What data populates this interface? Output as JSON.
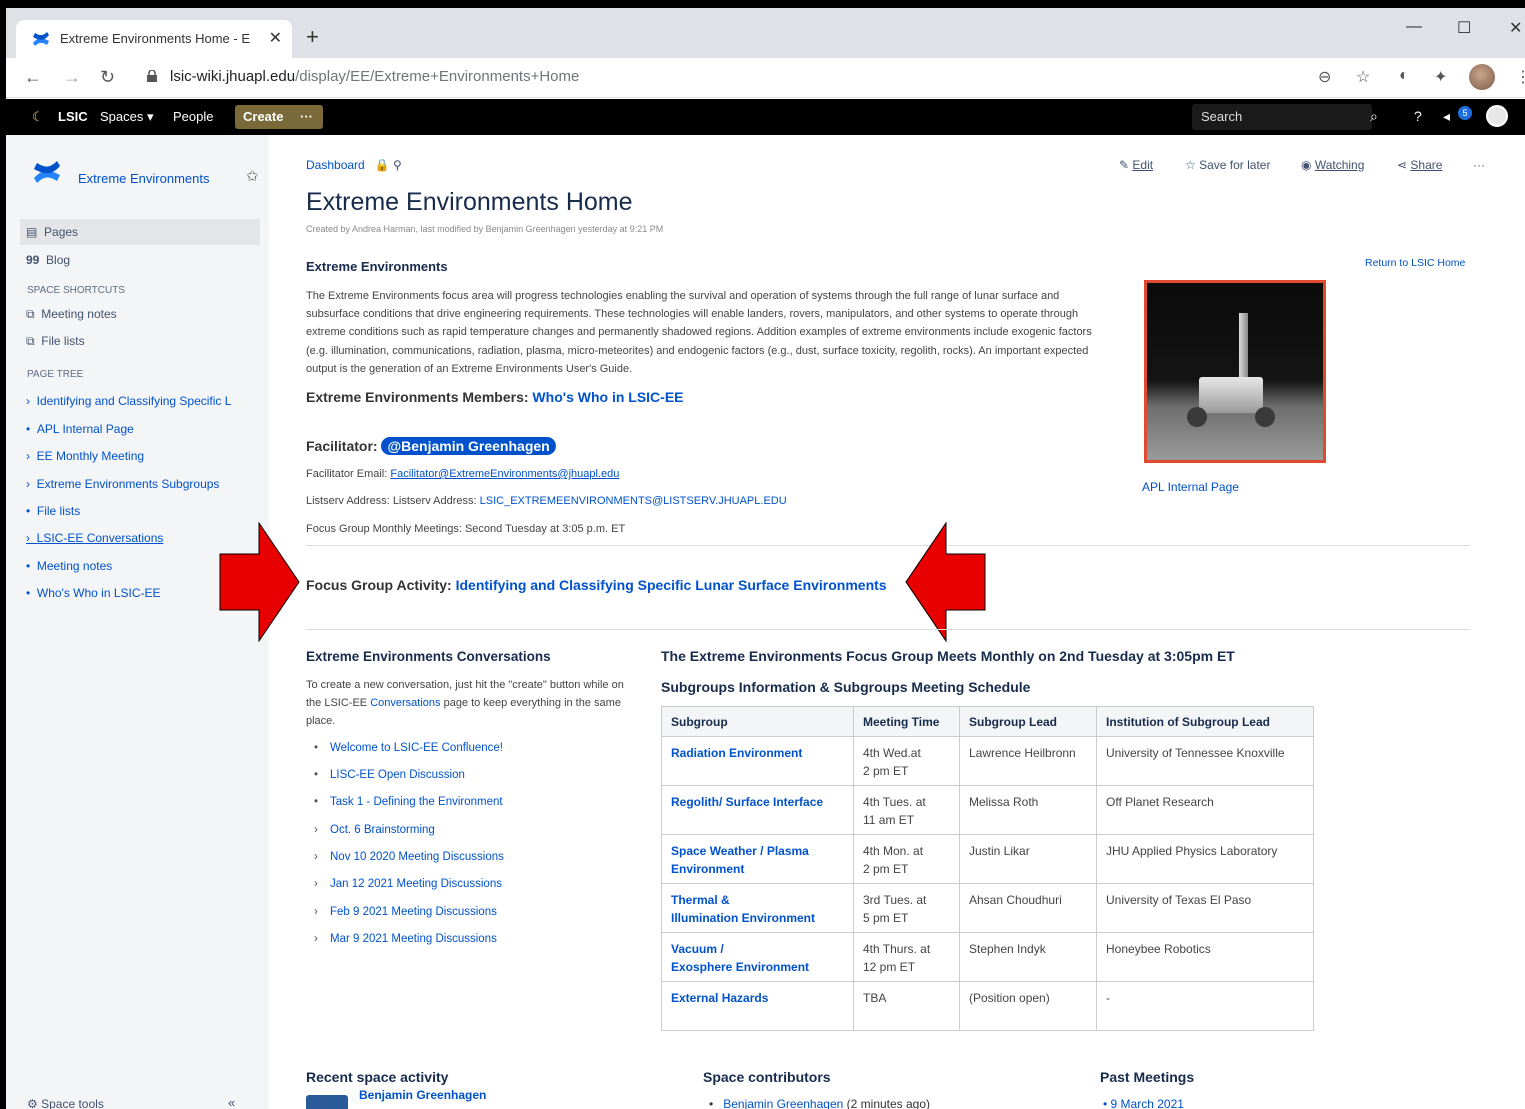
{
  "browser": {
    "tab_title": "Extreme Environments Home - E",
    "url_domain": "lsic-wiki.jhuapl.edu",
    "url_path": "/display/EE/Extreme+Environments+Home"
  },
  "topnav": {
    "logo": "LSIC",
    "spaces": "Spaces",
    "people": "People",
    "create": "Create",
    "more": "···",
    "search_placeholder": "Search",
    "notif_count": "5"
  },
  "sidebar": {
    "space_name": "Extreme Environments",
    "pages": "Pages",
    "blog": "Blog",
    "shortcuts_heading": "SPACE SHORTCUTS",
    "shortcuts": [
      "Meeting notes",
      "File lists"
    ],
    "tree_heading": "PAGE TREE",
    "tree": [
      {
        "marker": "›",
        "label": "Identifying and Classifying Specific L"
      },
      {
        "marker": "•",
        "label": "APL Internal Page"
      },
      {
        "marker": "›",
        "label": "EE Monthly Meeting"
      },
      {
        "marker": "›",
        "label": "Extreme Environments Subgroups"
      },
      {
        "marker": "•",
        "label": "File lists"
      },
      {
        "marker": "›",
        "label": "LSIC-EE Conversations"
      },
      {
        "marker": "•",
        "label": "Meeting notes"
      },
      {
        "marker": "•",
        "label": "Who's Who in LSIC-EE"
      }
    ],
    "space_tools": "Space tools",
    "collapse": "«"
  },
  "page": {
    "breadcrumb": "Dashboard",
    "actions": {
      "edit": "Edit",
      "save": "Save for later",
      "watching": "Watching",
      "share": "Share",
      "more": "···"
    },
    "title": "Extreme Environments Home",
    "byline": "Created by Andrea Harman, last modified by Benjamin Greenhagen yesterday at 9:21 PM",
    "return_link": "Return to LSIC Home",
    "section_heading": "Extreme Environments",
    "description": "The Extreme Environments focus area will progress technologies enabling the survival and operation of systems through the full range of lunar surface and subsurface conditions that drive engineering requirements. These technologies will enable landers, rovers, manipulators, and other systems to operate through extreme conditions such as rapid temperature changes and permanently shadowed regions. Addition examples of extreme environments include exogenic factors (e.g. illumination, communications, radiation, plasma, micro-meteorites) and endogenic factors (e.g., dust, surface toxicity, regolith, rocks). An important expected output is the generation of an Extreme Environments User's Guide.",
    "members_label": "Extreme Environments Members:",
    "members_link": "Who's Who in LSIC-EE",
    "facilitator_label": "Facilitator:",
    "facilitator_name": "@Benjamin Greenhagen",
    "fac_email_label": "Facilitator Email:",
    "fac_email": "Facilitator@ExtremeEnvironments@jhuapl.edu",
    "listserv_label": "Listserv Address: Listserv Address:",
    "listserv": "LSIC_EXTREMEENVIRONMENTS@LISTSERV.JHUAPL.EDU",
    "monthly": "Focus Group Monthly Meetings: Second Tuesday at 3:05 p.m. ET",
    "image_caption": "APL Internal Page",
    "fga_label": "Focus Group Activity:",
    "fga_link": "Identifying and Classifying Specific Lunar Surface Environments",
    "conv_heading": "Extreme Environments Conversations",
    "conv_text_1": "To create a new conversation, just hit the \"create\" button while on the LSIC-EE",
    "conv_text_link": "Conversations",
    "conv_text_2": "page to keep everything in the same place.",
    "conv_items": [
      {
        "marker": "•",
        "label": "Welcome to LSIC-EE Confluence!"
      },
      {
        "marker": "•",
        "label": "LISC-EE Open Discussion"
      },
      {
        "marker": "•",
        "label": "Task 1 - Defining the Environment"
      },
      {
        "marker": "›",
        "label": "Oct. 6 Brainstorming"
      },
      {
        "marker": "›",
        "label": "Nov 10 2020 Meeting Discussions"
      },
      {
        "marker": "›",
        "label": "Jan 12 2021 Meeting Discussions"
      },
      {
        "marker": "›",
        "label": "Feb 9 2021 Meeting Discussions"
      },
      {
        "marker": "›",
        "label": "Mar 9 2021 Meeting Discussions"
      }
    ],
    "sched_heading": "The Extreme Environments Focus Group Meets Monthly on 2nd Tuesday at 3:05pm ET",
    "sub_heading": "Subgroups Information & Subgroups Meeting Schedule",
    "table_headers": [
      "Subgroup",
      "Meeting Time",
      "Subgroup Lead",
      "Institution of Subgroup Lead"
    ],
    "table_rows": [
      {
        "sg1": "Radiation Environment",
        "sg2": "",
        "t1": "4th Wed.at",
        "t2": "2 pm ET",
        "lead": "Lawrence Heilbronn",
        "inst": "University of Tennessee Knoxville"
      },
      {
        "sg1": "Regolith/ Surface Interface",
        "sg2": "",
        "t1": "4th Tues. at",
        "t2": "11 am ET",
        "lead": "Melissa Roth",
        "inst": "Off Planet Research"
      },
      {
        "sg1": "Space Weather / Plasma",
        "sg2": "Environment",
        "t1": "4th Mon. at",
        "t2": "2 pm ET",
        "lead": "Justin Likar",
        "inst": "JHU Applied Physics Laboratory"
      },
      {
        "sg1": "Thermal &",
        "sg2": "Illumination Environment",
        "t1": "3rd Tues. at",
        "t2": "5 pm ET",
        "lead": "Ahsan Choudhuri",
        "inst": "University of Texas El Paso"
      },
      {
        "sg1": "Vacuum /",
        "sg2": "Exosphere Environment",
        "t1": "4th Thurs. at",
        "t2": "12 pm ET",
        "lead": "Stephen Indyk",
        "inst": "Honeybee Robotics"
      },
      {
        "sg1": "External Hazards",
        "sg2": "",
        "t1": "TBA",
        "t2": "",
        "lead": "(Position open)",
        "inst": "-"
      }
    ],
    "recent_heading": "Recent space activity",
    "recent_user": "Benjamin Greenhagen",
    "contrib_heading": "Space contributors",
    "contrib_name": "Benjamin Greenhagen",
    "contrib_time": "(2 minutes ago)",
    "past_heading": "Past Meetings",
    "past_item": "9 March 2021"
  }
}
